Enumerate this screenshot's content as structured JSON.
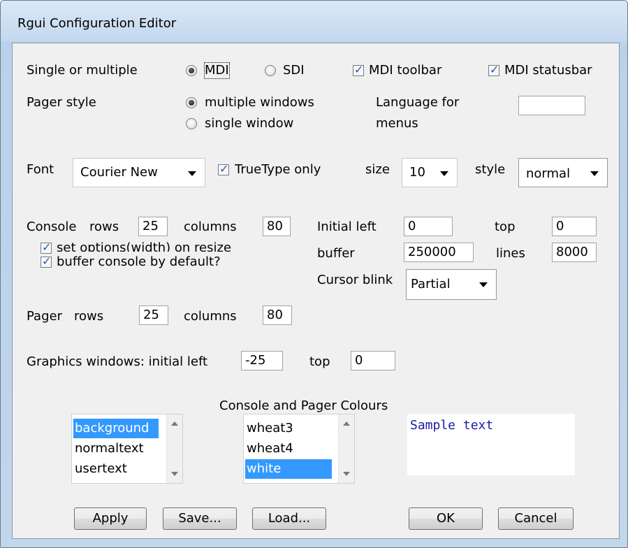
{
  "window": {
    "title": "Rgui Configuration Editor"
  },
  "mode": {
    "label": "Single or multiple",
    "mdi_label": "MDI",
    "sdi_label": "SDI",
    "mdi_toolbar_label": "MDI toolbar",
    "mdi_statusbar_label": "MDI statusbar"
  },
  "pager_style": {
    "label": "Pager style",
    "multiple_label": "multiple windows",
    "single_label": "single window"
  },
  "language": {
    "label_line1": "Language for",
    "label_line2": "menus",
    "value": ""
  },
  "font": {
    "label": "Font",
    "family": "Courier New",
    "truetype_label": "TrueType only",
    "size_label": "size",
    "size_value": "10",
    "style_label": "style",
    "style_value": "normal"
  },
  "console": {
    "label": "Console",
    "rows_label": "rows",
    "rows_value": "25",
    "columns_label": "columns",
    "columns_value": "80",
    "set_options_label": "set options(width) on resize",
    "buffer_default_label": "buffer console by default?",
    "initial_left_label": "Initial left",
    "initial_left_value": "0",
    "top_label": "top",
    "top_value": "0",
    "buffer_label": "buffer",
    "buffer_value": "250000",
    "lines_label": "lines",
    "lines_value": "8000",
    "cursor_blink_label": "Cursor blink",
    "cursor_blink_value": "Partial"
  },
  "pager": {
    "label": "Pager",
    "rows_label": "rows",
    "rows_value": "25",
    "columns_label": "columns",
    "columns_value": "80"
  },
  "graphics": {
    "label": "Graphics windows: initial left",
    "left_value": "-25",
    "top_label": "top",
    "top_value": "0"
  },
  "colours": {
    "heading": "Console and Pager Colours",
    "elements": [
      "background",
      "normaltext",
      "usertext"
    ],
    "selected_element": "background",
    "colour_names": [
      "wheat3",
      "wheat4",
      "white"
    ],
    "selected_colour": "white",
    "sample_text": "Sample text"
  },
  "buttons": {
    "apply": "Apply",
    "save": "Save...",
    "load": "Load...",
    "ok": "OK",
    "cancel": "Cancel"
  },
  "colors": {
    "selection": "#3399ff",
    "sample_text": "#1a1aa8"
  }
}
